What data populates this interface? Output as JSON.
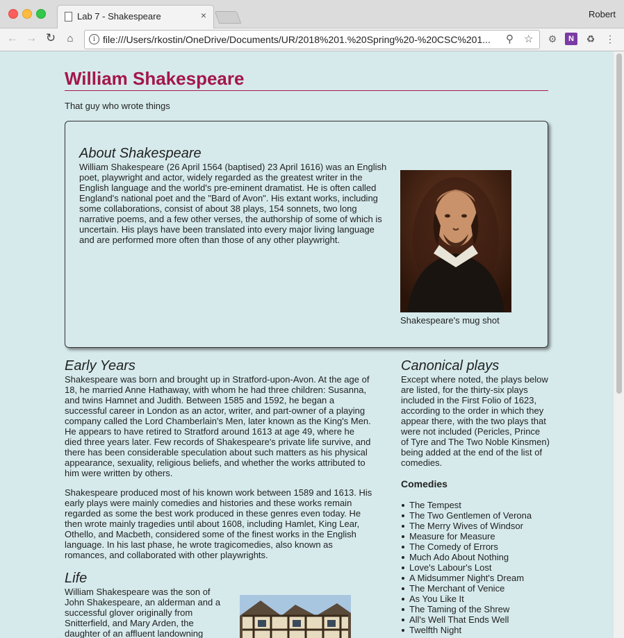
{
  "browser": {
    "tab_title": "Lab 7 - Shakespeare",
    "tab_close": "×",
    "user": "Robert",
    "url": "file:///Users/rkostin/OneDrive/Documents/UR/2018%201.%20Spring%20-%20CSC%201...",
    "icons": [
      "back-icon",
      "forward-icon",
      "reload-icon",
      "home-icon",
      "info-icon",
      "zoom-icon",
      "star-icon",
      "settings-extension-icon",
      "onenote-icon",
      "recycle-icon",
      "menu-icon"
    ]
  },
  "page": {
    "title": "William Shakespeare",
    "tagline": "That guy who wrote things",
    "about": {
      "heading": "About Shakespeare",
      "text": "William Shakespeare (26 April 1564 (baptised) 23 April 1616) was an English poet, playwright and actor, widely regarded as the greatest writer in the English language and the world's pre-eminent dramatist. He is often called England's national poet and the \"Bard of Avon\". His extant works, including some collaborations, consist of about 38 plays, 154 sonnets, two long narrative poems, and a few other verses, the authorship of some of which is uncertain. His plays have been translated into every major living language and are performed more often than those of any other playwright.",
      "caption": "Shakespeare's mug shot"
    },
    "early_years": {
      "heading": "Early Years",
      "p1": "Shakespeare was born and brought up in Stratford-upon-Avon. At the age of 18, he married Anne Hathaway, with whom he had three children: Susanna, and twins Hamnet and Judith. Between 1585 and 1592, he began a successful career in London as an actor, writer, and part-owner of a playing company called the Lord Chamberlain's Men, later known as the King's Men. He appears to have retired to Stratford around 1613 at age 49, where he died three years later. Few records of Shakespeare's private life survive, and there has been considerable speculation about such matters as his physical appearance, sexuality, religious beliefs, and whether the works attributed to him were written by others.",
      "p2": "Shakespeare produced most of his known work between 1589 and 1613. His early plays were mainly comedies and histories and these works remain regarded as some the best work produced in these genres even today. He then wrote mainly tragedies until about 1608, including Hamlet, King Lear, Othello, and Macbeth, considered some of the finest works in the English language. In his last phase, he wrote tragicomedies, also known as romances, and collaborated with other playwrights."
    },
    "life": {
      "heading": "Life",
      "text": "William Shakespeare was the son of John Shakespeare, an alderman and a successful glover originally from Snitterfield, and Mary Arden, the daughter of an affluent landowning"
    },
    "canonical": {
      "heading": "Canonical plays",
      "text": "Except where noted, the plays below are listed, for the thirty-six plays included in the First Folio of 1623, according to the order in which they appear there, with the two plays that were not included (Pericles, Prince of Tyre and The Two Noble Kinsmen) being added at the end of the list of comedies.",
      "comedies_heading": "Comedies",
      "comedies": [
        "The Tempest",
        "The Two Gentlemen of Verona",
        "The Merry Wives of Windsor",
        "Measure for Measure",
        "The Comedy of Errors",
        "Much Ado About Nothing",
        "Love's Labour's Lost",
        "A Midsummer Night's Dream",
        "The Merchant of Venice",
        "As You Like It",
        "The Taming of the Shrew",
        "All's Well That Ends Well",
        "Twelfth Night"
      ]
    }
  },
  "colors": {
    "page_bg": "#d6eaec",
    "title": "#a3174b",
    "text": "#222222"
  }
}
